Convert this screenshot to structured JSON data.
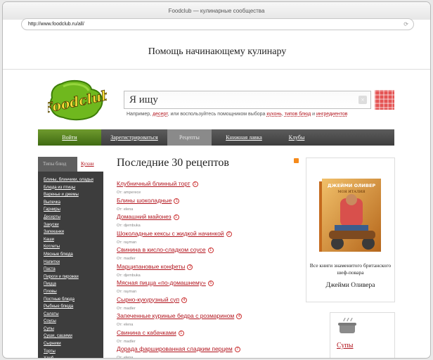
{
  "browser": {
    "title": "Foodclub — кулинарные сообщества",
    "url": "http://www.foodclub.ru/all/"
  },
  "header": {
    "tagline": "Помощь начинающему кулинару",
    "logo_text": "Foodclub"
  },
  "search": {
    "value": "Я ищу",
    "hint_prefix": "Например,",
    "hint_example": "десерт",
    "hint_middle": ", или воспользуйтесь помощником выбора",
    "hint_cuisine": "кухонь",
    "hint_dishtype": "типов блюд",
    "hint_and": "и",
    "hint_ingredients": "ингредиентов"
  },
  "nav": {
    "items": [
      "Войти",
      "Зарегистрироваться",
      "Рецепты",
      "Книжная лавка",
      "Клубы"
    ]
  },
  "sidebar": {
    "tab_types": "Типы блюд",
    "tab_cuisines": "Кухни",
    "items": [
      "Блины, блинчики, оладьи",
      "Блюда из птицы",
      "Варенье и джемы",
      "Выпечка",
      "Гарниры",
      "Десерты",
      "Закуски",
      "Запеканки",
      "Каши",
      "Котлеты",
      "Мясные блюда",
      "Напитки",
      "Паста",
      "Пироги и пирожки",
      "Пицца",
      "Пловы",
      "Постные блюда",
      "Рыбные блюда",
      "Салаты",
      "Соусы",
      "Супы",
      "Суши, сашими",
      "Сырники",
      "Торты",
      "Хлеб"
    ]
  },
  "main": {
    "heading": "Последние 30 рецептов",
    "recipes": [
      {
        "title": "Клубничный блинный торт",
        "count": "1",
        "author": "От: amperece"
      },
      {
        "title": "Блины шоколадные",
        "count": "1",
        "author": "От: elena"
      },
      {
        "title": "Домашний майонез",
        "count": "1",
        "author": "От: djembuka"
      },
      {
        "title": "Шоколадные кексы с жидкой начинкой",
        "count": "2",
        "author": "От: rayman"
      },
      {
        "title": "Свинина в кисло-сладком соусе",
        "count": "1",
        "author": "От: madler"
      },
      {
        "title": "Марципановые конфеты",
        "count": "3",
        "author": "От: djembuka"
      },
      {
        "title": "Мясная пицца «по-домашнему»",
        "count": "5",
        "author": "От: rayman"
      },
      {
        "title": "Сырно-кукурузный суп",
        "count": "4",
        "author": "От: madler"
      },
      {
        "title": "Запеченные куриные бедра с розмарином",
        "count": "4",
        "author": "От: elena"
      },
      {
        "title": "Свинина с кабачками",
        "count": "1",
        "author": "От: madler"
      },
      {
        "title": "Дорада фаршированная сладким перцем",
        "count": "7",
        "author": "От: elena"
      }
    ]
  },
  "ad": {
    "book_author": "ДЖЕЙМИ ОЛИВЕР",
    "book_title": "МОЯ ИТАЛИЯ",
    "text": "Все книги знаменитого британского шеф-повара",
    "name": "Джейми Оливера"
  },
  "category": {
    "label": "Супы"
  },
  "colors": {
    "accent": "#b2151e",
    "nav_dark": "#4a4a4a",
    "nav_active": "#5a8620",
    "search_button": "#e45454"
  }
}
